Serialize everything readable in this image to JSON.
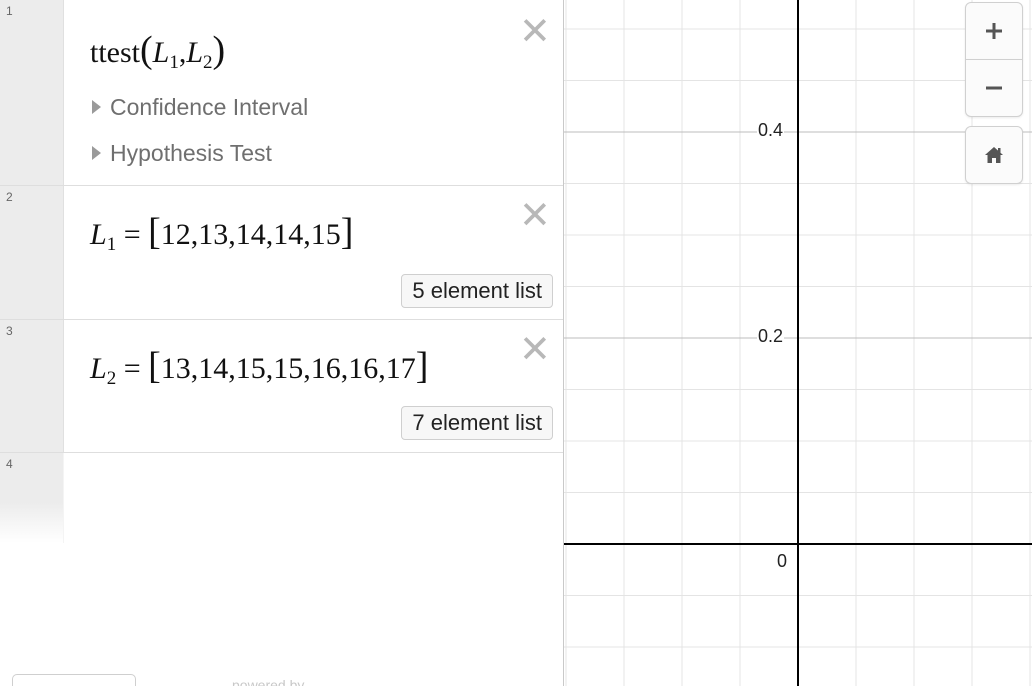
{
  "expressions": [
    {
      "number": "1",
      "func": "ttest",
      "arg1": "L",
      "arg1_sub": "1",
      "arg2": "L",
      "arg2_sub": "2",
      "folders": [
        "Confidence Interval",
        "Hypothesis Test"
      ]
    },
    {
      "number": "2",
      "var": "L",
      "sub": "1",
      "values": "12,13,14,14,15",
      "badge": "5 element list"
    },
    {
      "number": "3",
      "var": "L",
      "sub": "2",
      "values": "13,14,15,15,16,16,17",
      "badge": "7 element list"
    },
    {
      "number": "4"
    }
  ],
  "powered_by": "powered by",
  "graph": {
    "y_ticks": [
      "0.4",
      "0.2",
      "0"
    ]
  },
  "zoom_controls": {
    "zoom_in_icon": "plus-icon",
    "zoom_out_icon": "minus-icon",
    "home_icon": "home-icon"
  },
  "colors": {
    "gridline": "#e4e4e4",
    "major_gridline": "#bdbdbd",
    "axis": "#000000",
    "gutter": "#ececec",
    "delete_icon": "#b8b8b8"
  }
}
